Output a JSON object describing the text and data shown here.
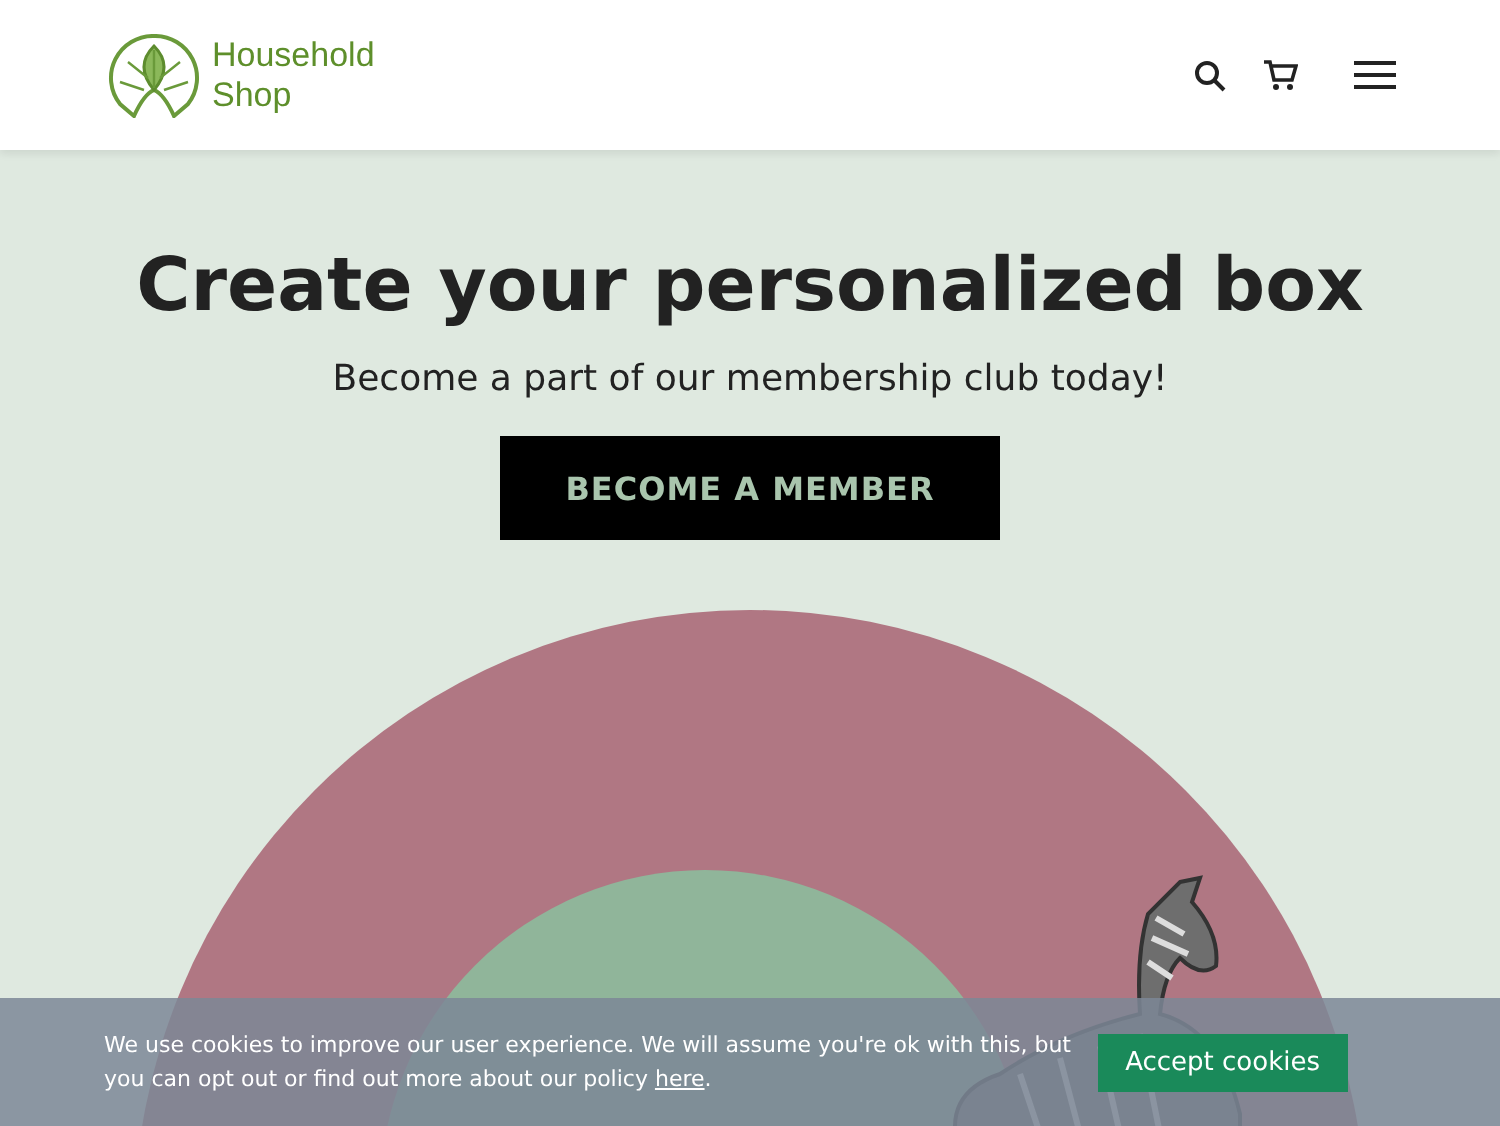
{
  "header": {
    "logo_text": [
      "Household",
      "Shop"
    ]
  },
  "hero": {
    "title": "Create your personalized box",
    "subtitle": "Become a part of our membership club today!",
    "button": "BECOME A MEMBER"
  },
  "cookie_banner": {
    "message": "We use cookies to improve our user experience. We will assume you're ok with this, but you can opt out or find out more about our policy ",
    "link": "here",
    "message_end": ".",
    "button": "Accept cookies"
  }
}
